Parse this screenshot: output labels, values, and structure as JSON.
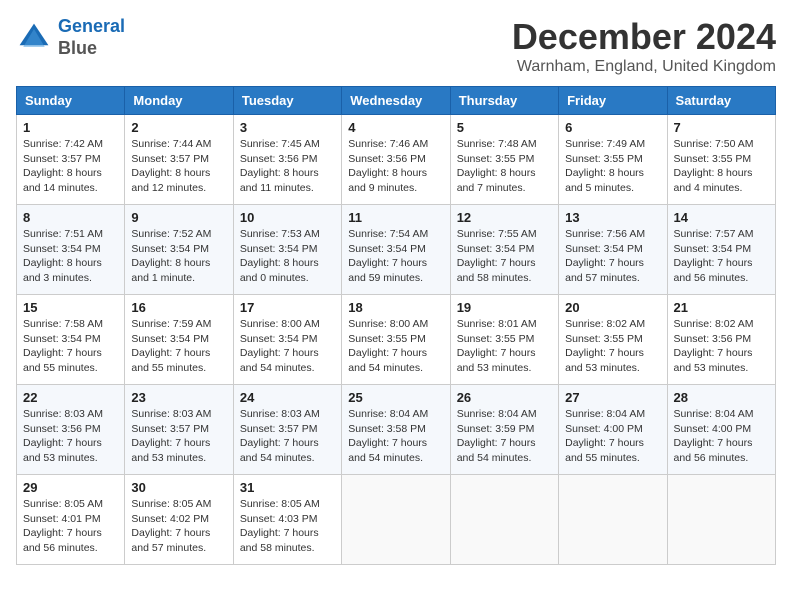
{
  "header": {
    "logo_line1": "General",
    "logo_line2": "Blue",
    "title": "December 2024",
    "subtitle": "Warnham, England, United Kingdom"
  },
  "weekdays": [
    "Sunday",
    "Monday",
    "Tuesday",
    "Wednesday",
    "Thursday",
    "Friday",
    "Saturday"
  ],
  "weeks": [
    [
      {
        "day": "1",
        "sunrise": "7:42 AM",
        "sunset": "3:57 PM",
        "daylight": "8 hours and 14 minutes."
      },
      {
        "day": "2",
        "sunrise": "7:44 AM",
        "sunset": "3:57 PM",
        "daylight": "8 hours and 12 minutes."
      },
      {
        "day": "3",
        "sunrise": "7:45 AM",
        "sunset": "3:56 PM",
        "daylight": "8 hours and 11 minutes."
      },
      {
        "day": "4",
        "sunrise": "7:46 AM",
        "sunset": "3:56 PM",
        "daylight": "8 hours and 9 minutes."
      },
      {
        "day": "5",
        "sunrise": "7:48 AM",
        "sunset": "3:55 PM",
        "daylight": "8 hours and 7 minutes."
      },
      {
        "day": "6",
        "sunrise": "7:49 AM",
        "sunset": "3:55 PM",
        "daylight": "8 hours and 5 minutes."
      },
      {
        "day": "7",
        "sunrise": "7:50 AM",
        "sunset": "3:55 PM",
        "daylight": "8 hours and 4 minutes."
      }
    ],
    [
      {
        "day": "8",
        "sunrise": "7:51 AM",
        "sunset": "3:54 PM",
        "daylight": "8 hours and 3 minutes."
      },
      {
        "day": "9",
        "sunrise": "7:52 AM",
        "sunset": "3:54 PM",
        "daylight": "8 hours and 1 minute."
      },
      {
        "day": "10",
        "sunrise": "7:53 AM",
        "sunset": "3:54 PM",
        "daylight": "8 hours and 0 minutes."
      },
      {
        "day": "11",
        "sunrise": "7:54 AM",
        "sunset": "3:54 PM",
        "daylight": "7 hours and 59 minutes."
      },
      {
        "day": "12",
        "sunrise": "7:55 AM",
        "sunset": "3:54 PM",
        "daylight": "7 hours and 58 minutes."
      },
      {
        "day": "13",
        "sunrise": "7:56 AM",
        "sunset": "3:54 PM",
        "daylight": "7 hours and 57 minutes."
      },
      {
        "day": "14",
        "sunrise": "7:57 AM",
        "sunset": "3:54 PM",
        "daylight": "7 hours and 56 minutes."
      }
    ],
    [
      {
        "day": "15",
        "sunrise": "7:58 AM",
        "sunset": "3:54 PM",
        "daylight": "7 hours and 55 minutes."
      },
      {
        "day": "16",
        "sunrise": "7:59 AM",
        "sunset": "3:54 PM",
        "daylight": "7 hours and 55 minutes."
      },
      {
        "day": "17",
        "sunrise": "8:00 AM",
        "sunset": "3:54 PM",
        "daylight": "7 hours and 54 minutes."
      },
      {
        "day": "18",
        "sunrise": "8:00 AM",
        "sunset": "3:55 PM",
        "daylight": "7 hours and 54 minutes."
      },
      {
        "day": "19",
        "sunrise": "8:01 AM",
        "sunset": "3:55 PM",
        "daylight": "7 hours and 53 minutes."
      },
      {
        "day": "20",
        "sunrise": "8:02 AM",
        "sunset": "3:55 PM",
        "daylight": "7 hours and 53 minutes."
      },
      {
        "day": "21",
        "sunrise": "8:02 AM",
        "sunset": "3:56 PM",
        "daylight": "7 hours and 53 minutes."
      }
    ],
    [
      {
        "day": "22",
        "sunrise": "8:03 AM",
        "sunset": "3:56 PM",
        "daylight": "7 hours and 53 minutes."
      },
      {
        "day": "23",
        "sunrise": "8:03 AM",
        "sunset": "3:57 PM",
        "daylight": "7 hours and 53 minutes."
      },
      {
        "day": "24",
        "sunrise": "8:03 AM",
        "sunset": "3:57 PM",
        "daylight": "7 hours and 54 minutes."
      },
      {
        "day": "25",
        "sunrise": "8:04 AM",
        "sunset": "3:58 PM",
        "daylight": "7 hours and 54 minutes."
      },
      {
        "day": "26",
        "sunrise": "8:04 AM",
        "sunset": "3:59 PM",
        "daylight": "7 hours and 54 minutes."
      },
      {
        "day": "27",
        "sunrise": "8:04 AM",
        "sunset": "4:00 PM",
        "daylight": "7 hours and 55 minutes."
      },
      {
        "day": "28",
        "sunrise": "8:04 AM",
        "sunset": "4:00 PM",
        "daylight": "7 hours and 56 minutes."
      }
    ],
    [
      {
        "day": "29",
        "sunrise": "8:05 AM",
        "sunset": "4:01 PM",
        "daylight": "7 hours and 56 minutes."
      },
      {
        "day": "30",
        "sunrise": "8:05 AM",
        "sunset": "4:02 PM",
        "daylight": "7 hours and 57 minutes."
      },
      {
        "day": "31",
        "sunrise": "8:05 AM",
        "sunset": "4:03 PM",
        "daylight": "7 hours and 58 minutes."
      },
      null,
      null,
      null,
      null
    ]
  ]
}
